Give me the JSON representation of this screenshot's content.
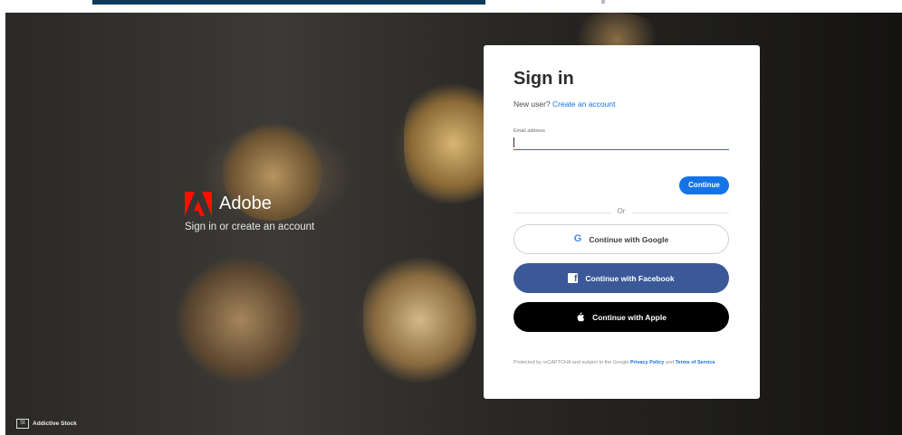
{
  "brand": {
    "name": "Adobe",
    "tagline": "Sign in or create an account",
    "logo_color": "#fa0f00"
  },
  "stock": {
    "badge": "St",
    "label": "Addictive Stock"
  },
  "signin": {
    "title": "Sign in",
    "new_user_text": "New user?",
    "create_account_link": "Create an account",
    "email_label": "Email address",
    "email_value": "",
    "continue_label": "Continue",
    "or_text": "Or",
    "google_label": "Continue with Google",
    "facebook_label": "Continue with Facebook",
    "apple_label": "Continue with Apple",
    "legal_prefix": "Protected by reCAPTCHA and subject to the Google",
    "privacy_link": "Privacy Policy",
    "and_text": "and",
    "terms_link": "Terms of Service",
    "legal_suffix": "."
  },
  "colors": {
    "accent": "#1473e6",
    "facebook": "#3b5998",
    "apple": "#000000"
  },
  "icons": {
    "google": "google-icon",
    "facebook": "facebook-icon",
    "apple": "apple-icon",
    "adobe": "adobe-logo"
  }
}
